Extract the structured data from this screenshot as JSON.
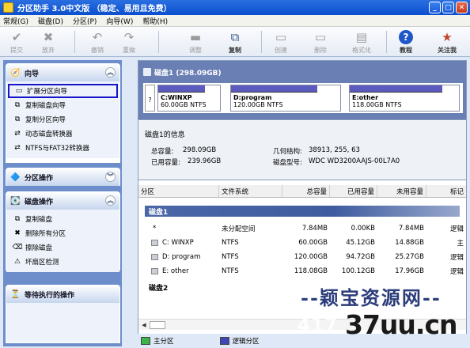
{
  "window": {
    "title": "分区助手 3.0中文版 （稳定、易用且免费）"
  },
  "menu": [
    "常规(G)",
    "磁盘(D)",
    "分区(P)",
    "向导(W)",
    "帮助(H)"
  ],
  "toolbar": [
    {
      "label": "提交",
      "icon": "check-icon",
      "enabled": false
    },
    {
      "label": "放弃",
      "icon": "cancel-x-icon",
      "enabled": false
    },
    {
      "label": "撤销",
      "icon": "undo-icon",
      "enabled": false
    },
    {
      "label": "重做",
      "icon": "redo-icon",
      "enabled": false
    },
    {
      "label": "调整",
      "icon": "resize-disk-icon",
      "enabled": false
    },
    {
      "label": "复制",
      "icon": "copy-disk-icon",
      "enabled": true
    },
    {
      "label": "创建",
      "icon": "create-partition-icon",
      "enabled": false
    },
    {
      "label": "删除",
      "icon": "delete-partition-icon",
      "enabled": false
    },
    {
      "label": "格式化",
      "icon": "format-icon",
      "enabled": false
    },
    {
      "label": "教程",
      "icon": "help-icon",
      "enabled": true
    },
    {
      "label": "关注我",
      "icon": "follow-icon",
      "enabled": true
    }
  ],
  "sidebar": {
    "wizard": {
      "title": "向导",
      "items": [
        "扩展分区向导",
        "复制磁盘向导",
        "复制分区向导",
        "动态磁盘转换器",
        "NTFS与FAT32转换器"
      ]
    },
    "partition_ops": {
      "title": "分区操作"
    },
    "disk_ops": {
      "title": "磁盘操作",
      "items": [
        "复制磁盘",
        "删除所有分区",
        "擦除磁盘",
        "坏扇区检测"
      ]
    },
    "pending": {
      "title": "等待执行的操作"
    }
  },
  "diskmap": {
    "header": "磁盘1 (298.09GB)",
    "unalloc_marks": [
      "",
      "?"
    ],
    "partitions": [
      {
        "name": "C:WINXP",
        "size": "60.00GB NTFS"
      },
      {
        "name": "D:program",
        "size": "120.00GB NTFS"
      },
      {
        "name": "E:other",
        "size": "118.00GB NTFS"
      }
    ]
  },
  "info": {
    "title": "磁盘1的信息",
    "total_label": "总容量:",
    "total_value": "298.09GB",
    "used_label": "已用容量:",
    "used_value": "239.96GB",
    "geometry_label": "几何结构:",
    "geometry_value": "38913, 255, 63",
    "model_label": "磁盘型号:",
    "model_value": "WDC WD3200AAJS-00L7A0"
  },
  "table": {
    "columns": [
      "分区",
      "文件系统",
      "总容量",
      "已用容量",
      "未用容量",
      "标记"
    ],
    "group1": "磁盘1",
    "rows": [
      {
        "name": "*",
        "fs": "未分配空间",
        "total": "7.84MB",
        "used": "0.00KB",
        "free": "7.84MB",
        "flag": "逻辑"
      },
      {
        "name": "C: WINXP",
        "fs": "NTFS",
        "total": "60.00GB",
        "used": "45.12GB",
        "free": "14.88GB",
        "flag": "主"
      },
      {
        "name": "D: program",
        "fs": "NTFS",
        "total": "120.00GB",
        "used": "94.72GB",
        "free": "25.27GB",
        "flag": "逻辑"
      },
      {
        "name": "E: other",
        "fs": "NTFS",
        "total": "118.08GB",
        "used": "100.12GB",
        "free": "17.96GB",
        "flag": "逻辑"
      }
    ],
    "group2": "磁盘2"
  },
  "legend": [
    "主分区",
    "逻辑分区"
  ],
  "watermark": {
    "cn": "--颖宝资源网--",
    "num": "417",
    "site": "37uu.cn"
  },
  "colors": {
    "accent": "#0b4fcf",
    "used_bar": "#5b5bbf",
    "selected_border": "#1616c8"
  }
}
